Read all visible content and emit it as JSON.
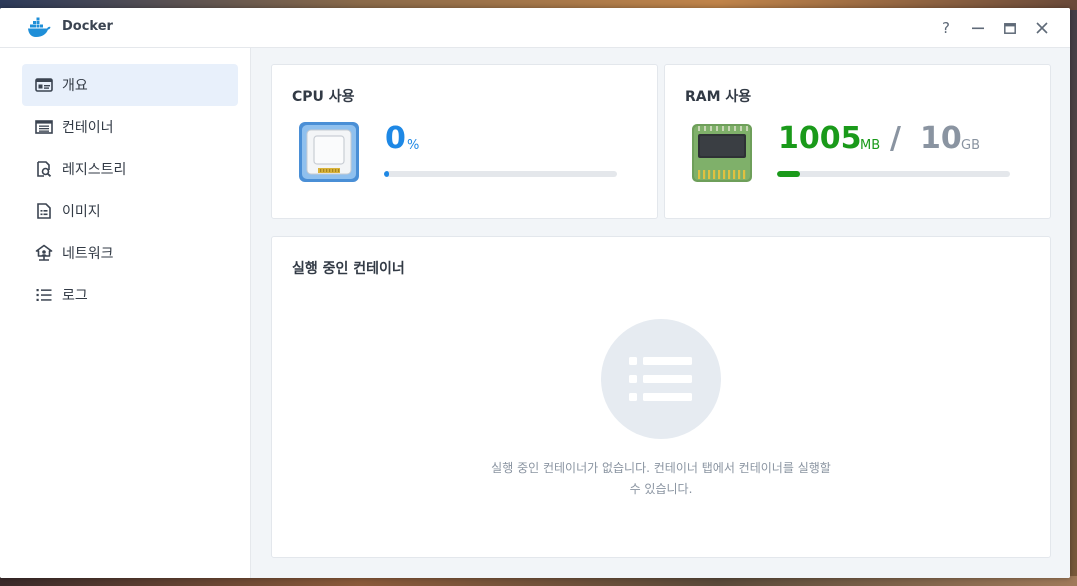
{
  "window": {
    "title": "Docker",
    "icon": "docker-whale-icon",
    "controls": {
      "help": "?",
      "minimize": "minimize-icon",
      "maximize": "maximize-icon",
      "close": "close-icon"
    }
  },
  "sidebar": {
    "items": [
      {
        "label": "개요",
        "icon": "overview-icon",
        "active": true
      },
      {
        "label": "컨테이너",
        "icon": "container-icon",
        "active": false
      },
      {
        "label": "레지스트리",
        "icon": "registry-icon",
        "active": false
      },
      {
        "label": "이미지",
        "icon": "image-icon",
        "active": false
      },
      {
        "label": "네트워크",
        "icon": "network-icon",
        "active": false
      },
      {
        "label": "로그",
        "icon": "log-icon",
        "active": false
      }
    ]
  },
  "cpu": {
    "title": "CPU 사용",
    "value": "0",
    "unit": "%",
    "usage_fraction": 0.02,
    "color": "#1e88e5"
  },
  "ram": {
    "title": "RAM 사용",
    "used": "1005",
    "used_unit": "MB",
    "separator": "/",
    "total": "10",
    "total_unit": "GB",
    "usage_fraction": 0.098,
    "color": "#1a9a1a"
  },
  "running": {
    "title": "실행 중인 컨테이너",
    "empty_message": "실행 중인 컨테이너가 없습니다. 컨테이너 탭에서 컨테이너를 실행할 수 있습니다."
  }
}
